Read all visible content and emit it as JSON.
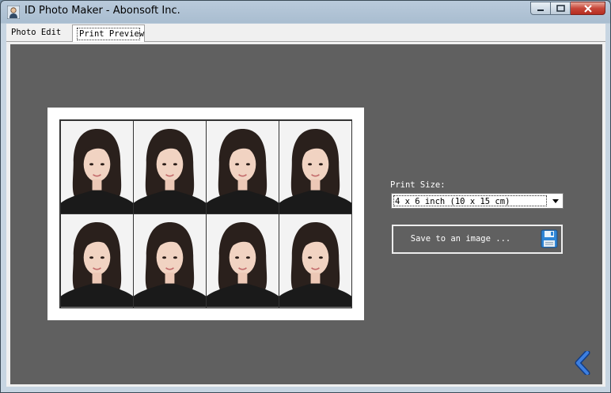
{
  "window": {
    "title": "ID Photo Maker - Abonsoft Inc.",
    "icon": "id-person-icon",
    "controls": [
      "minimize-icon",
      "maximize-icon",
      "close-icon"
    ]
  },
  "tabs": [
    {
      "label": "Photo Edit",
      "active": false
    },
    {
      "label": "Print Preview",
      "active": true
    }
  ],
  "preview": {
    "photo_count": 8,
    "layout": "4 x 2",
    "background_color": "#606060"
  },
  "print_size": {
    "label": "Print Size:",
    "selected": "4 x 6 inch (10 x 15 cm)"
  },
  "save_button": {
    "label": "Save to an image ...",
    "icon": "floppy-disk-icon"
  },
  "back_button": {
    "icon": "chevron-left-icon",
    "color": "#2a5fb0"
  }
}
